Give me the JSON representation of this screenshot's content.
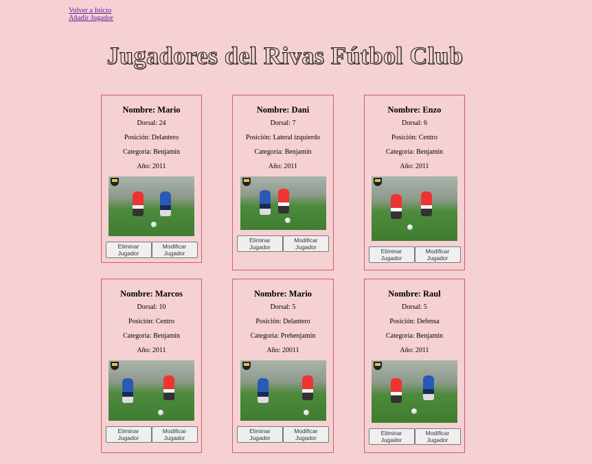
{
  "nav": {
    "home_link": "Volver a Inicio",
    "add_link": "Añadir Jugador"
  },
  "title": "Jugadores del Rivas Fútbol Club",
  "labels": {
    "delete": "Eliminar Jugador",
    "modify": "Modificar Jugador"
  },
  "players": [
    {
      "name": "Nombre: Mario",
      "dorsal": "Dorsal: 24",
      "position": "Posición: Delantero",
      "category": "Categoría: Benjamín",
      "year": "Año: 2011"
    },
    {
      "name": "Nombre: Dani",
      "dorsal": "Dorsal: 7",
      "position": "Posición: Lateral izquierdo",
      "category": "Categoría: Benjamín",
      "year": "Año: 2011"
    },
    {
      "name": "Nombre: Enzo",
      "dorsal": "Dorsal: 6",
      "position": "Posición: Centro",
      "category": "Categoría: Benjamín",
      "year": "Año: 2011"
    },
    {
      "name": "Nombre: Marcos",
      "dorsal": "Dorsal: 10",
      "position": "Posición: Centro",
      "category": "Categoría: Benjamín",
      "year": "Año: 2011"
    },
    {
      "name": "Nombre: Mario",
      "dorsal": "Dorsal: 5",
      "position": "Posición: Delantero",
      "category": "Categoría: Prebenjamín",
      "year": "Año: 20011"
    },
    {
      "name": "Nombre: Raul",
      "dorsal": "Dorsal: 5",
      "position": "Posición: Defensa",
      "category": "Categoría: Benjamín",
      "year": "Año: 2011"
    }
  ]
}
